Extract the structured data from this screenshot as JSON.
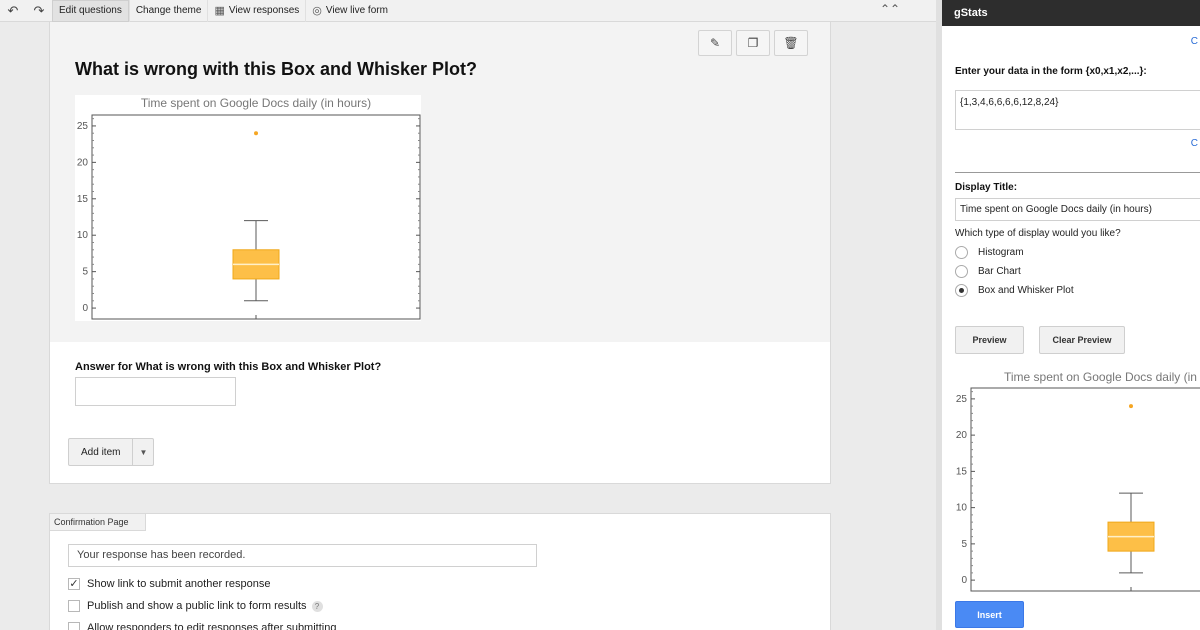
{
  "toolbar": {
    "undo_icon": "undo-icon",
    "redo_icon": "redo-icon",
    "edit_questions": "Edit questions",
    "change_theme": "Change theme",
    "view_responses": "View responses",
    "view_live_form": "View live form",
    "collapse_icon": "double-chevron-up-icon"
  },
  "question": {
    "title": "What is wrong with this Box and Whisker Plot?",
    "answer_label": "Answer for What is wrong with this Box and Whisker Plot?",
    "answer_value": "",
    "actions": [
      "pencil-icon",
      "duplicate-icon",
      "trash-icon"
    ],
    "add_item": "Add item"
  },
  "confirmation": {
    "tab_label": "Confirmation Page",
    "response_text": "Your response has been recorded.",
    "options": [
      {
        "label": "Show link to submit another response",
        "checked": true
      },
      {
        "label": "Publish and show a public link to form results",
        "checked": false,
        "help": "?"
      },
      {
        "label": "Allow responders to edit responses after submitting",
        "checked": false
      }
    ]
  },
  "panel": {
    "header": "gStats",
    "top_link": "C",
    "data_label": "Enter your data in the form {x0,x1,x2,...}:",
    "data_value": "{1,3,4,6,6,6,6,12,8,24}",
    "mid_link": "C",
    "display_title_label": "Display Title:",
    "display_title_value": "Time spent on Google Docs daily (in hours)",
    "display_type_question": "Which type of display would you like?",
    "display_types": [
      {
        "label": "Histogram",
        "selected": false
      },
      {
        "label": "Bar Chart",
        "selected": false
      },
      {
        "label": "Box and Whisker Plot",
        "selected": true
      }
    ],
    "preview_button": "Preview",
    "clear_preview_button": "Clear Preview",
    "insert_button": "Insert"
  },
  "colors": {
    "box_fill": "#fdbf47",
    "median": "#fff0c8",
    "outlier": "#f5a623",
    "whisker": "#5a5a5a",
    "insert_blue": "#4a8af4"
  },
  "chart_data": [
    {
      "type": "box",
      "title": "Time spent on Google Docs daily (in hours)",
      "ylim": [
        -1.5,
        26.5
      ],
      "yticks": [
        0,
        5,
        10,
        15,
        20,
        25
      ],
      "box": {
        "min": 1,
        "q1": 4,
        "median": 6,
        "q3": 8,
        "max": 12
      },
      "outliers": [
        24
      ]
    },
    {
      "type": "box",
      "title": "Time spent on Google Docs daily (in hours)",
      "ylim": [
        -1.5,
        26.5
      ],
      "yticks": [
        0,
        5,
        10,
        15,
        20,
        25
      ],
      "box": {
        "min": 1,
        "q1": 4,
        "median": 6,
        "q3": 8,
        "max": 12
      },
      "outliers": [
        24
      ]
    }
  ]
}
